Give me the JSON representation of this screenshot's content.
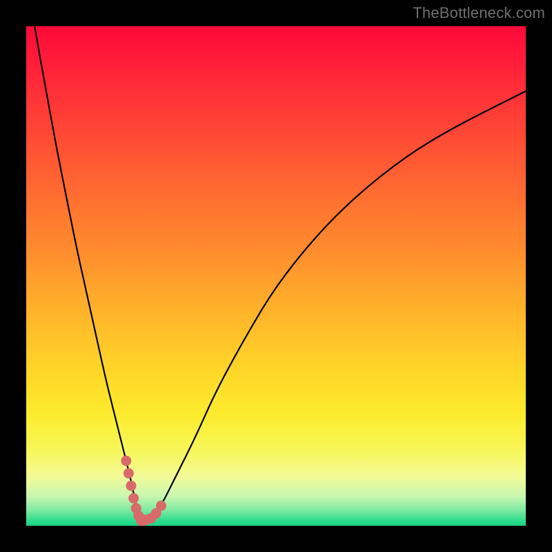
{
  "watermark": "TheBottleneck.com",
  "chart_data": {
    "type": "line",
    "title": "",
    "xlabel": "",
    "ylabel": "",
    "xlim": [
      0,
      100
    ],
    "ylim": [
      0,
      100
    ],
    "series": [
      {
        "name": "bottleneck-curve",
        "x": [
          0,
          2,
          4,
          6,
          8,
          10,
          12,
          14,
          16,
          18,
          20,
          21,
          22,
          23,
          25,
          27,
          30,
          34,
          38,
          44,
          50,
          58,
          66,
          76,
          86,
          100
        ],
        "values": [
          110,
          98,
          87,
          76,
          66,
          56,
          47,
          38,
          29,
          21,
          13,
          9,
          4,
          1,
          1,
          4,
          10,
          18,
          27,
          38,
          48,
          58,
          66,
          74,
          80,
          87
        ]
      }
    ],
    "datapoints": {
      "name": "highlighted-points",
      "x": [
        20,
        20.5,
        21,
        21.5,
        22,
        22.5,
        23,
        23.5,
        24,
        25,
        26,
        27
      ],
      "values": [
        13,
        10.5,
        8,
        5.5,
        3.5,
        2,
        1,
        1,
        1.2,
        1.5,
        2.5,
        4
      ]
    }
  }
}
